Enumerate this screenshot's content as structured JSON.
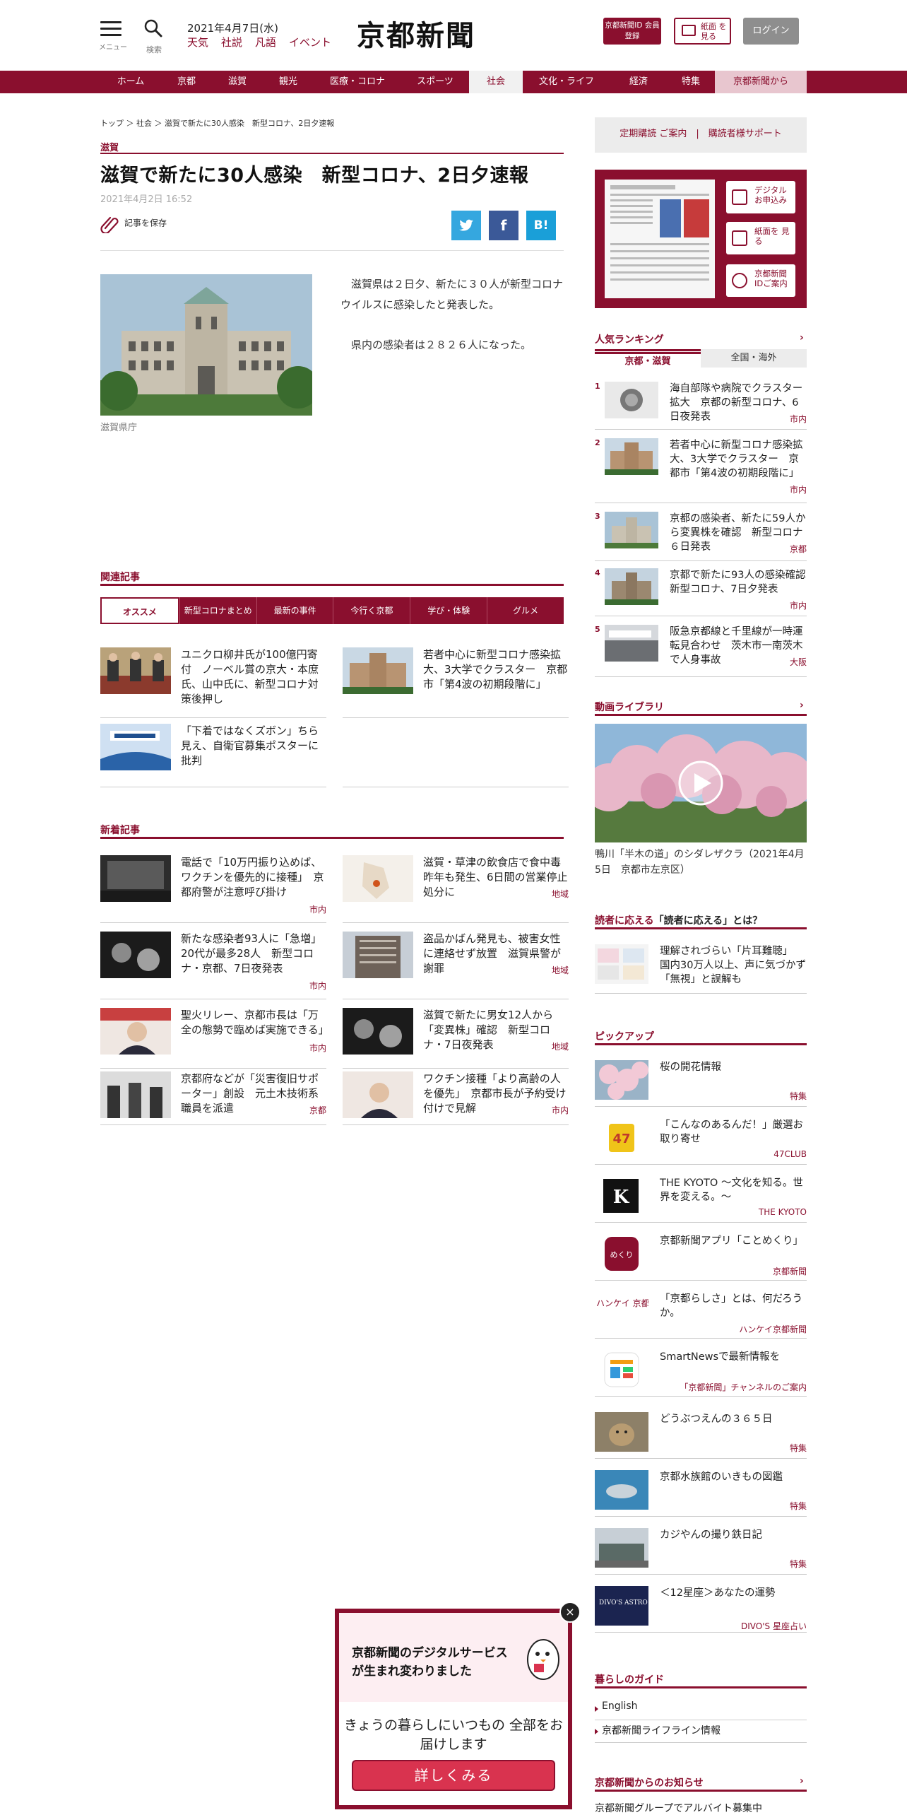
{
  "header": {
    "menu_label": "メニュー",
    "search_label": "検索",
    "date": "2021年4月7日(水)",
    "links": [
      "天気",
      "社説",
      "凡語",
      "イベント"
    ],
    "logo": "京都新聞",
    "id_button": "京都新聞ID 会員登録",
    "paper_button": "紙面 を見る",
    "login_button": "ログイン"
  },
  "nav": {
    "items": [
      "ホーム",
      "京都",
      "滋賀",
      "観光",
      "医療・コロナ",
      "スポーツ",
      "社会",
      "文化・ライフ",
      "経済",
      "特集",
      "京都新聞から"
    ],
    "active": "社会",
    "accent": "#8a0f2e"
  },
  "article": {
    "breadcrumb": "トップ ＞ 社会 ＞ 滋賀で新たに30人感染　新型コロナ、2日夕速報",
    "category": "滋賀",
    "title": "滋賀で新たに30人感染　新型コロナ、2日夕速報",
    "date": "2021年4月2日 16:52",
    "save_label": "記事を保存",
    "share": {
      "twitter": "t",
      "facebook": "f",
      "hatena": "B!"
    },
    "photo_caption": "滋賀県庁",
    "paragraphs": [
      "　滋賀県は２日夕、新たに３０人が新型コロナウイルスに感染したと発表した。",
      "　県内の感染者は２８２６人になった。"
    ]
  },
  "related": {
    "heading": "関連記事",
    "tabs": [
      "オススメ",
      "新型コロナまとめ",
      "最新の事件",
      "今行く京都",
      "学び・体験",
      "グルメ"
    ],
    "items": [
      {
        "title": "ユニクロ柳井氏が100億円寄付　ノーベル賞の京大・本庶氏、山中氏に、新型コロナ対策後押し"
      },
      {
        "title": "若者中心に新型コロナ感染拡大、3大学でクラスター　京都市「第4波の初期段階に」"
      },
      {
        "title": "「下着ではなくズボン」ちら見え、自衛官募集ポスターに批判"
      }
    ]
  },
  "latest": {
    "heading": "新着記事",
    "items": [
      {
        "title": "電話で「10万円振り込めば、ワクチンを優先的に接種」　京都府警が注意呼び掛け",
        "tag": "市内"
      },
      {
        "title": "滋賀・草津の飲食店で食中毒　昨年も発生、6日間の営業停止処分に",
        "tag": "地域"
      },
      {
        "title": "新たな感染者93人に「急増」20代が最多28人　新型コロナ・京都、7日夜発表",
        "tag": "市内"
      },
      {
        "title": "盗品かばん発見も、被害女性に連絡せず放置　滋賀県警が謝罪",
        "tag": "地域"
      },
      {
        "title": "聖火リレー、京都市長は「万全の態勢で臨めば実施できる」",
        "tag": "市内"
      },
      {
        "title": "滋賀で新たに男女12人から「変異株」確認　新型コロナ・7日夜発表",
        "tag": "地域"
      },
      {
        "title": "京都府などが「災害復旧サポーター」創設　元土木技術系職員を派遣",
        "tag": "京都"
      },
      {
        "title": "ワクチン接種「より高齢の人を優先」　京都市長が予約受け付けで見解",
        "tag": "市内"
      }
    ]
  },
  "sidebar": {
    "subscribe": "定期購読 ご案内　|　購読者様サポート",
    "paper_buttons": [
      "デジタル お申込み",
      "紙面を 見る",
      "京都新聞 IDご案内"
    ],
    "ranking": {
      "heading": "人気ランキング",
      "tabs": [
        "京都・滋賀",
        "全国・海外"
      ],
      "items": [
        {
          "rank": "1",
          "title": "海自部隊や病院でクラスター拡大　京都の新型コロナ、6日夜発表",
          "tag": "市内"
        },
        {
          "rank": "2",
          "title": "若者中心に新型コロナ感染拡大、3大学でクラスター　京都市「第4波の初期段階に」",
          "tag": "市内"
        },
        {
          "rank": "3",
          "title": "京都の感染者、新たに59人から変異株を確認　新型コロナ６日発表",
          "tag": "京都"
        },
        {
          "rank": "4",
          "title": "京都で新たに93人の感染確認　新型コロナ、7日夕発表",
          "tag": "市内"
        },
        {
          "rank": "5",
          "title": "阪急京都線と千里線が一時運転見合わせ　茨木市一南茨木で人身事故",
          "tag": "大阪"
        }
      ]
    },
    "video": {
      "heading": "動画ライブラリ",
      "caption": "鴨川「半木の道」のシダレザクラ（2021年4月5日　京都市左京区）"
    },
    "reader": {
      "heading_accent": "読者に応える",
      "heading": "「読者に応える」とは？",
      "title": "理解されづらい「片耳難聴」　国内30万人以上、声に気づかず「無視」と誤解も"
    },
    "pickup": {
      "heading": "ピックアップ",
      "items": [
        {
          "title": "桜の開花情報",
          "tag": "特集"
        },
        {
          "title": "「こんなのあるんだ！」厳選お取り寄せ",
          "tag": "47CLUB"
        },
        {
          "title": "THE KYOTO ～文化を知る。世界を変える。～",
          "tag": "THE KYOTO"
        },
        {
          "title": "京都新聞アプリ「ことめくり」",
          "tag": "京都新聞"
        },
        {
          "title": "「京都らしさ」とは、何だろうか。",
          "tag": "ハンケイ京都新聞"
        },
        {
          "title": "SmartNewsで最新情報を",
          "tag": "「京都新聞」チャンネルのご案内"
        },
        {
          "title": "どうぶつえんの３６５日",
          "tag": "特集"
        },
        {
          "title": "京都水族館のいきもの図鑑",
          "tag": "特集"
        },
        {
          "title": "カジやんの撮り鉄日記",
          "tag": "特集"
        },
        {
          "title": "＜12星座＞あなたの運勢",
          "tag": "DIVO'S 星座占い"
        }
      ],
      "logos": {
        "47club": "47",
        "kyoto": "K",
        "app": "めくり",
        "hankei": "ハンケイ 京都新聞",
        "divos": "DIVO'S ASTRO TIMES"
      }
    },
    "guide": {
      "heading": "暮らしのガイド",
      "items": [
        "English",
        "京都新聞ライフライン情報"
      ]
    },
    "notice": {
      "heading": "京都新聞からのお知らせ",
      "first": "京都新聞グループでアルバイト募集中"
    }
  },
  "popup": {
    "heading": "京都新聞のデジタルサービスが生まれ変わりました",
    "sub": "きょうの暮らしにいつもの 全部をお届けします",
    "button": "詳しくみる",
    "close": "×"
  }
}
